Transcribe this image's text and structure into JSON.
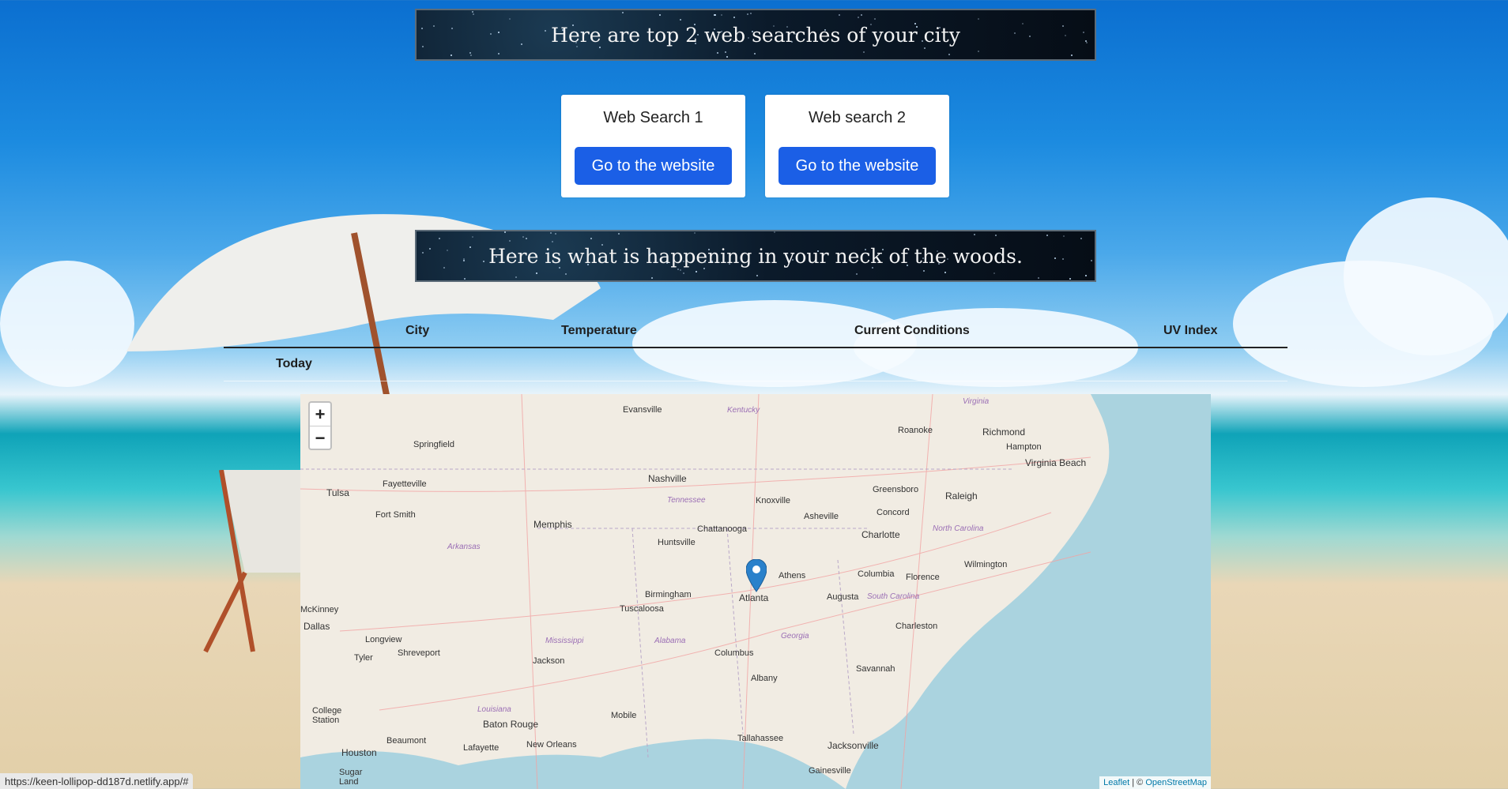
{
  "banners": {
    "top": "Here are top 2 web searches of your city",
    "middle": "Here is what is happening in your neck of the woods."
  },
  "cards": [
    {
      "title": "Web Search 1",
      "button": "Go to the website"
    },
    {
      "title": "Web search 2",
      "button": "Go to the website"
    }
  ],
  "table": {
    "headers": [
      "City",
      "Temperature",
      "Current Conditions",
      "UV Index"
    ],
    "rows": [
      {
        "label": "Today"
      }
    ]
  },
  "map": {
    "zoom_in": "+",
    "zoom_out": "−",
    "attribution_leaflet": "Leaflet",
    "attribution_sep": " | © ",
    "attribution_osm": "OpenStreetMap",
    "cities": [
      "Evansville",
      "Springfield",
      "Richmond",
      "Hampton",
      "Virginia Beach",
      "Roanoke",
      "Nashville",
      "Knoxville",
      "Greensboro",
      "Raleigh",
      "Tulsa",
      "Fayetteville",
      "Fort Smith",
      "Memphis",
      "Chattanooga",
      "Asheville",
      "Concord",
      "Charlotte",
      "Huntsville",
      "Wilmington",
      "Athens",
      "Columbia",
      "Florence",
      "Atlanta",
      "Birmingham",
      "Tuscaloosa",
      "Augusta",
      "McKinney",
      "Dallas",
      "Longview",
      "Tyler",
      "Shreveport",
      "Jackson",
      "Columbus",
      "Charleston",
      "Savannah",
      "Albany",
      "College Station",
      "Baton Rouge",
      "Mobile",
      "Tallahassee",
      "Jacksonville",
      "Houston",
      "Beaumont",
      "Lafayette",
      "New Orleans",
      "Gainesville",
      "Sugar Land"
    ],
    "states": [
      "Virginia",
      "Kentucky",
      "Tennessee",
      "North Carolina",
      "Arkansas",
      "South Carolina",
      "Mississippi",
      "Alabama",
      "Georgia",
      "Louisiana"
    ],
    "colors": {
      "water": "#aad3df",
      "land": "#f1ece3",
      "marker": "#2a81cb"
    }
  },
  "status_bar": "https://keen-lollipop-dd187d.netlify.app/#"
}
